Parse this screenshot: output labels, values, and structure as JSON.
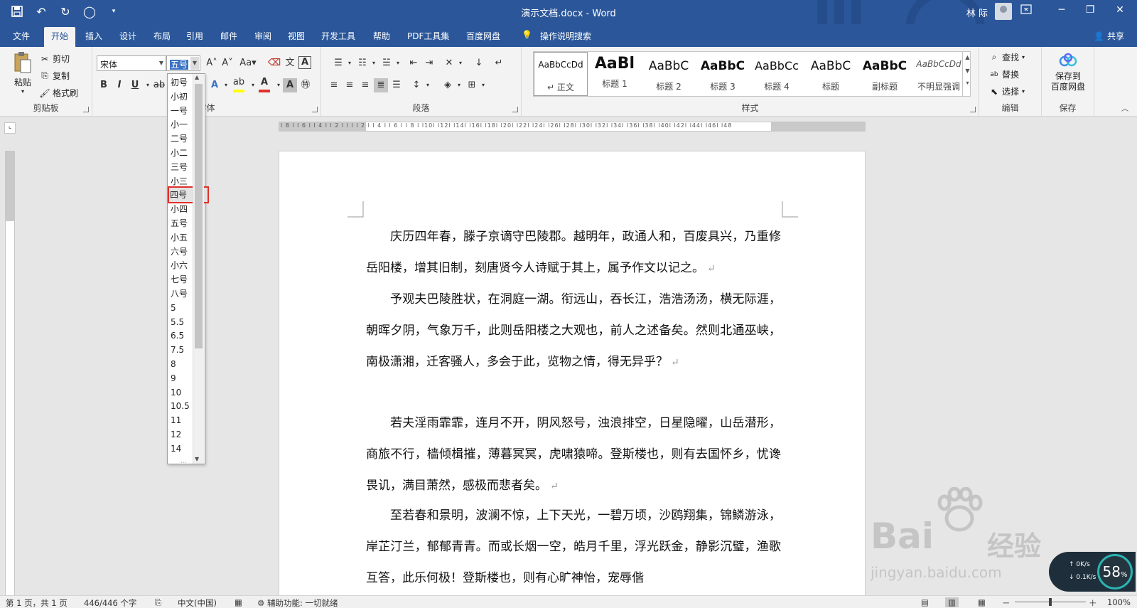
{
  "app": {
    "title": "演示文档.docx - Word",
    "user": "林 际",
    "share": "共享"
  },
  "qat": {
    "save_icon": "save-icon",
    "undo_icon": "undo-icon",
    "redo_icon": "redo-icon",
    "circle_icon": "circle-icon",
    "customize_icon": "chevron-down-icon"
  },
  "tabs": [
    "文件",
    "开始",
    "插入",
    "设计",
    "布局",
    "引用",
    "邮件",
    "审阅",
    "视图",
    "开发工具",
    "帮助",
    "PDF工具集",
    "百度网盘"
  ],
  "active_tab": "开始",
  "tell_me": "操作说明搜索",
  "clipboard": {
    "paste": "粘贴",
    "cut": "剪切",
    "copy": "复制",
    "format_painter": "格式刷",
    "label": "剪贴板"
  },
  "font": {
    "name": "宋体",
    "size": "五号",
    "label": "字体",
    "case_label": "Aa"
  },
  "paragraph": {
    "label": "段落"
  },
  "styles": {
    "label": "样式",
    "items": [
      {
        "sample": "AaBbCcDd",
        "name": "正文"
      },
      {
        "sample": "AaBl",
        "name": "标题 1"
      },
      {
        "sample": "AaBbC",
        "name": "标题 2"
      },
      {
        "sample": "AaBbC",
        "name": "标题 3"
      },
      {
        "sample": "AaBbCc",
        "name": "标题 4"
      },
      {
        "sample": "AaBbC",
        "name": "标题"
      },
      {
        "sample": "AaBbC",
        "name": "副标题"
      },
      {
        "sample": "AaBbCcDd",
        "name": "不明显强调"
      }
    ]
  },
  "editing": {
    "find": "查找",
    "replace": "替换",
    "select": "选择",
    "label": "编辑"
  },
  "save_group": {
    "button": "保存到\n百度网盘",
    "line1": "保存到",
    "line2": "百度网盘",
    "label": "保存"
  },
  "font_size_dropdown": {
    "options": [
      "初号",
      "小初",
      "一号",
      "小一",
      "二号",
      "小二",
      "三号",
      "小三",
      "四号",
      "小四",
      "五号",
      "小五",
      "六号",
      "小六",
      "七号",
      "八号",
      "5",
      "5.5",
      "6.5",
      "7.5",
      "8",
      "9",
      "10",
      "10.5",
      "11",
      "12",
      "14"
    ],
    "highlighted": "四号"
  },
  "ruler": {
    "ticks": "l 8 l  l 6 l  l 4 l  l 2 l  l  l  l 2 l  l 4 l  l 6 l  l 8 l  l10l  l12l  l14l  l16l  l18l  l20l  l22l  l24l  l26l  l28l  l30l  l32l  l34l  l36l  l38l  l40l  l42l  l44l  l46l  l48"
  },
  "document": {
    "paragraphs": [
      "庆历四年春，滕子京谪守巴陵郡。越明年，政通人和，百废具兴，乃重修岳阳楼，增其旧制，刻唐贤今人诗赋于其上，属予作文以记之。",
      "予观夫巴陵胜状，在洞庭一湖。衔远山，吞长江，浩浩汤汤，横无际涯，朝晖夕阴，气象万千，此则岳阳楼之大观也，前人之述备矣。然则北通巫峡，南极潇湘，迁客骚人，多会于此，览物之情，得无异乎？",
      "若夫淫雨霏霏，连月不开，阴风怒号，浊浪排空，日星隐曜，山岳潜形，商旅不行，樯倾楫摧，薄暮冥冥，虎啸猿啼。登斯楼也，则有去国怀乡，忧谗畏讥，满目萧然，感极而悲者矣。",
      "至若春和景明，波澜不惊，上下天光，一碧万顷，沙鸥翔集，锦鳞游泳，岸芷汀兰，郁郁青青。而或长烟一空，皓月千里，浮光跃金，静影沉璧，渔歌互答，此乐何极！登斯楼也，则有心旷神怡，宠辱偕"
    ],
    "paragraph_mark": "↵"
  },
  "status": {
    "page": "第 1 页，共 1 页",
    "words": "446/446 个字",
    "language": "中文(中国)",
    "accessibility": "辅助功能: 一切就绪",
    "zoom": "100%"
  },
  "watermark": {
    "brand": "Bai",
    "brand_cn": "经验",
    "url": "jingyan.baidu.com"
  },
  "network": {
    "up": "0K/s",
    "down": "0.1K/s",
    "percent": "58",
    "percent_unit": "%"
  },
  "colors": {
    "brand": "#2b579a",
    "ribbon": "#f3f3f3",
    "highlight_border": "#e0302a",
    "font_color_bar": "#e0302a",
    "highlight_bar": "#ffff00"
  }
}
